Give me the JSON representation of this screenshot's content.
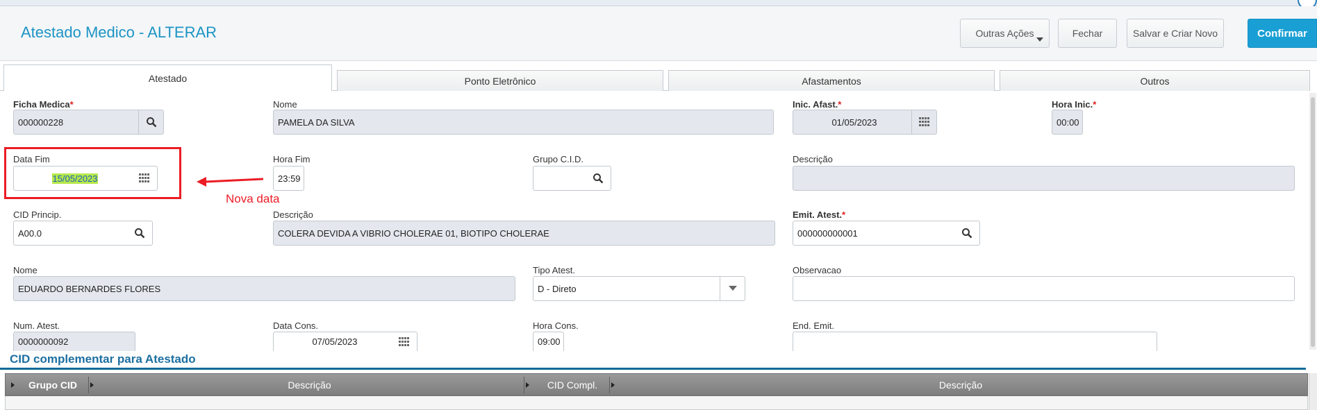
{
  "header": {
    "title": "Atestado Medico - ALTERAR",
    "buttons": {
      "outras_acoes": "Outras Ações",
      "fechar": "Fechar",
      "salvar_criar": "Salvar e Criar Novo",
      "confirmar": "Confirmar"
    }
  },
  "tabs": [
    "Atestado",
    "Ponto Eletrônico",
    "Afastamentos",
    "Outros"
  ],
  "form": {
    "ficha_medica": {
      "label": "Ficha Medica",
      "value": "000000228"
    },
    "nome": {
      "label": "Nome",
      "value": "PAMELA DA SILVA"
    },
    "inic_afast": {
      "label": "Inic. Afast.",
      "value": "01/05/2023"
    },
    "hora_inic": {
      "label": "Hora Inic.",
      "value": "00:00"
    },
    "data_fim": {
      "label": "Data Fim",
      "value": "15/05/2023"
    },
    "hora_fim": {
      "label": "Hora Fim",
      "value": "23:59"
    },
    "grupo_cid": {
      "label": "Grupo C.I.D.",
      "value": ""
    },
    "descricao1": {
      "label": "Descrição",
      "value": ""
    },
    "cid_princip": {
      "label": "CID Princip.",
      "value": "A00.0"
    },
    "descricao2": {
      "label": "Descrição",
      "value": "COLERA DEVIDA A VIBRIO CHOLERAE 01, BIOTIPO CHOLERAE"
    },
    "emit_atest": {
      "label": "Emit. Atest.",
      "value": "000000000001"
    },
    "nome2": {
      "label": "Nome",
      "value": "EDUARDO BERNARDES FLORES"
    },
    "tipo_atest": {
      "label": "Tipo Atest.",
      "value": "D - Direto"
    },
    "observacao": {
      "label": "Observacao",
      "value": ""
    },
    "num_atest": {
      "label": "Num. Atest.",
      "value": "0000000092"
    },
    "data_cons": {
      "label": "Data Cons.",
      "value": "07/05/2023"
    },
    "hora_cons": {
      "label": "Hora Cons.",
      "value": "09:00"
    },
    "end_emit": {
      "label": "End. Emit.",
      "value": ""
    }
  },
  "annotation": {
    "text": "Nova data",
    "color": "#ec1c24"
  },
  "section": {
    "title": "CID complementar para Atestado",
    "columns": [
      "Grupo CID",
      "Descrição",
      "CID Compl.",
      "Descrição"
    ]
  },
  "colors": {
    "accent": "#1a9fd4",
    "title": "#1c94c4",
    "required": "#e02020",
    "highlight": "#b6e84a"
  },
  "icons": {
    "lookup": "magnifier-icon",
    "date": "calendar-grid-icon",
    "select": "chevron-down-icon"
  }
}
